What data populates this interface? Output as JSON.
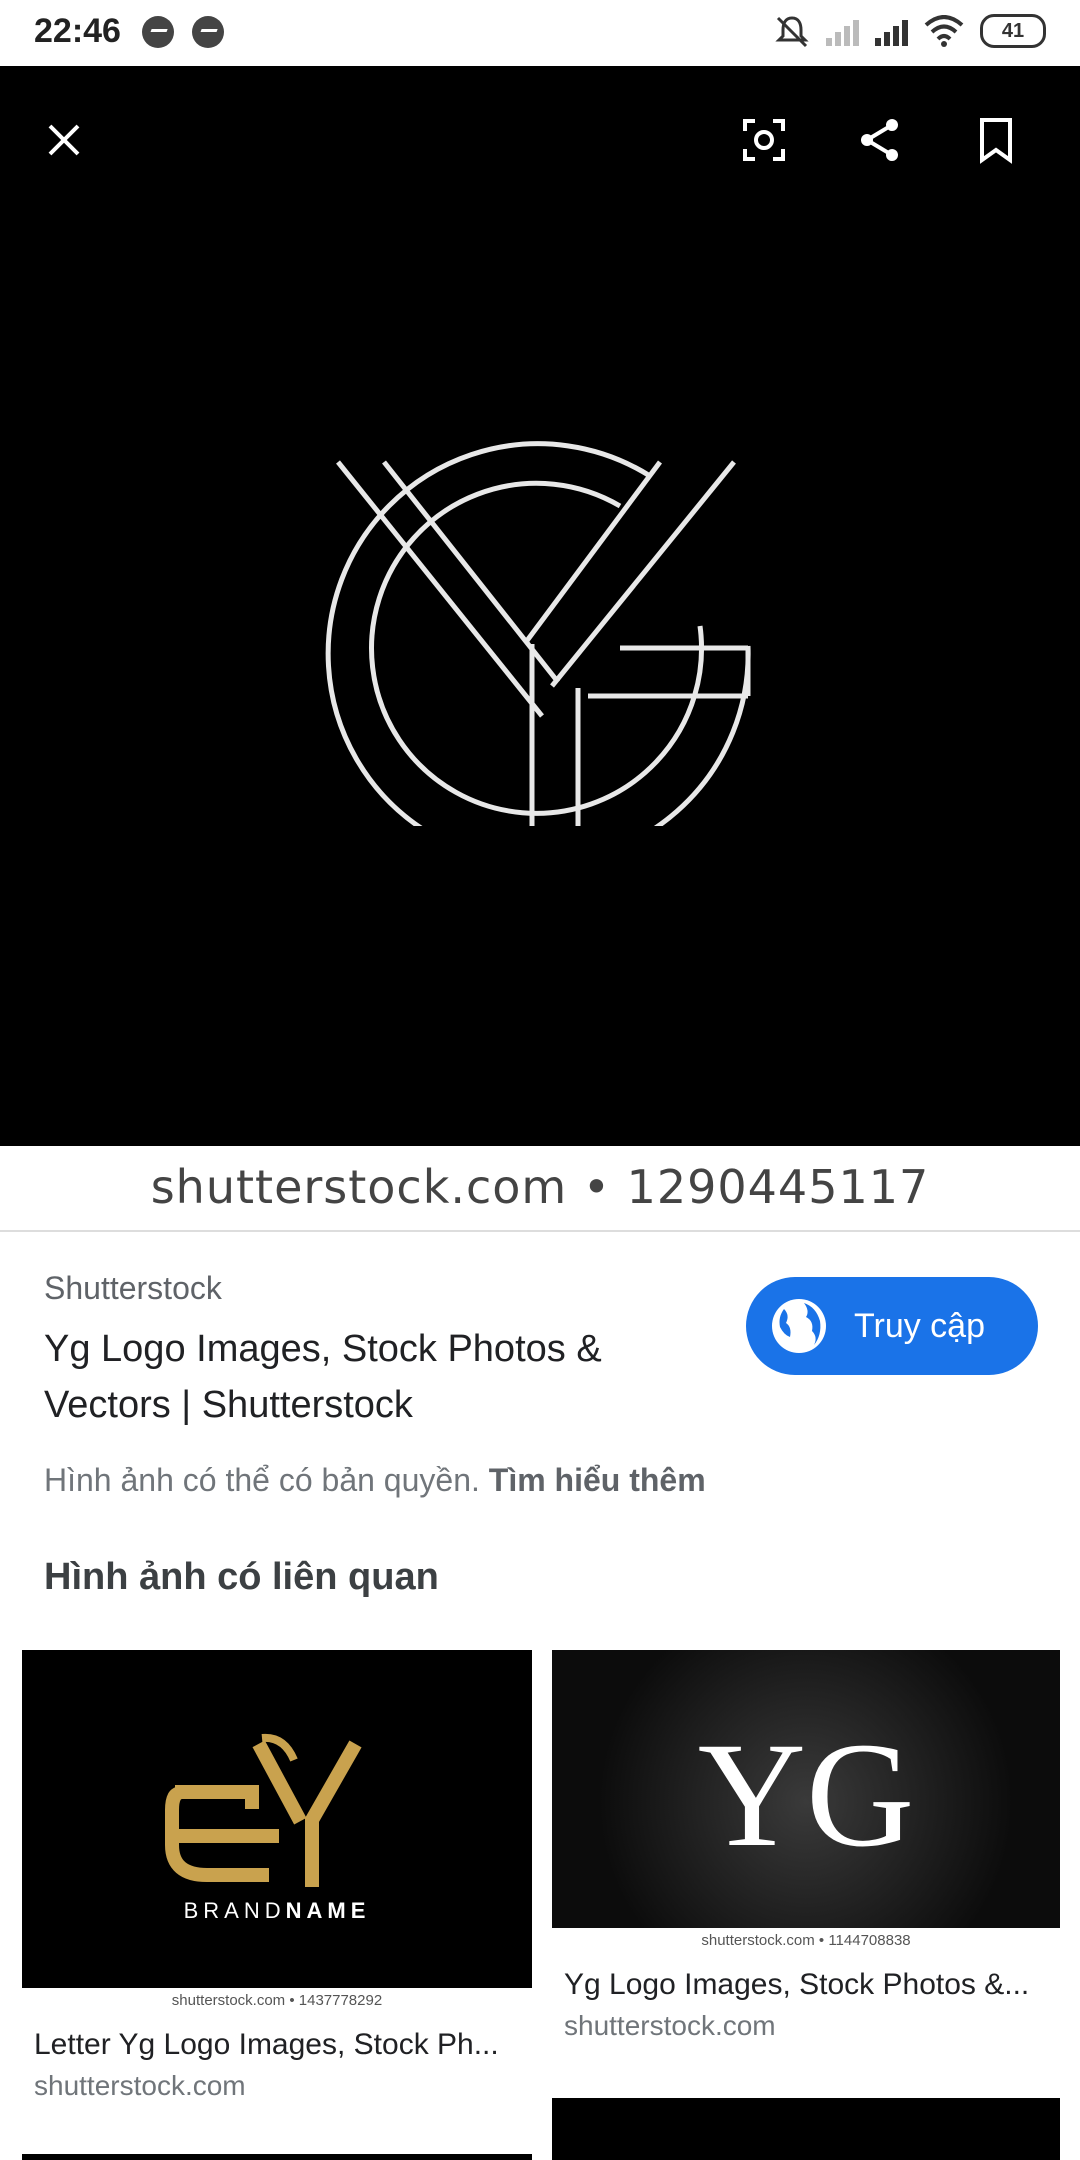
{
  "status_bar": {
    "time": "22:46",
    "battery": "41"
  },
  "viewer": {
    "close_icon": "close-icon",
    "lens_icon": "lens-icon",
    "share_icon": "share-icon",
    "bookmark_icon": "bookmark-icon",
    "watermark": "shutterstock.com • 1290445117"
  },
  "result": {
    "source": "Shutterstock",
    "title": "Yg Logo Images, Stock Photos & Vectors | Shutterstock",
    "copyright_text": "Hình ảnh có thể có bản quyền.",
    "learn_more": "Tìm hiểu thêm",
    "visit_label": "Truy cập"
  },
  "related": {
    "heading": "Hình ảnh có liên quan",
    "items": [
      {
        "title": "Letter Yg Logo Images, Stock Ph...",
        "domain": "shutterstock.com",
        "watermark": "shutterstock.com • 1437778292",
        "brand_light": "BRAND",
        "brand_bold": "NAME"
      },
      {
        "title": "Yg Logo Images, Stock Photos &...",
        "domain": "shutterstock.com",
        "watermark": "shutterstock.com • 1144708838",
        "logo_text": "YG"
      }
    ]
  },
  "colors": {
    "accent": "#1a73e8",
    "gold": "#c9a24e"
  }
}
